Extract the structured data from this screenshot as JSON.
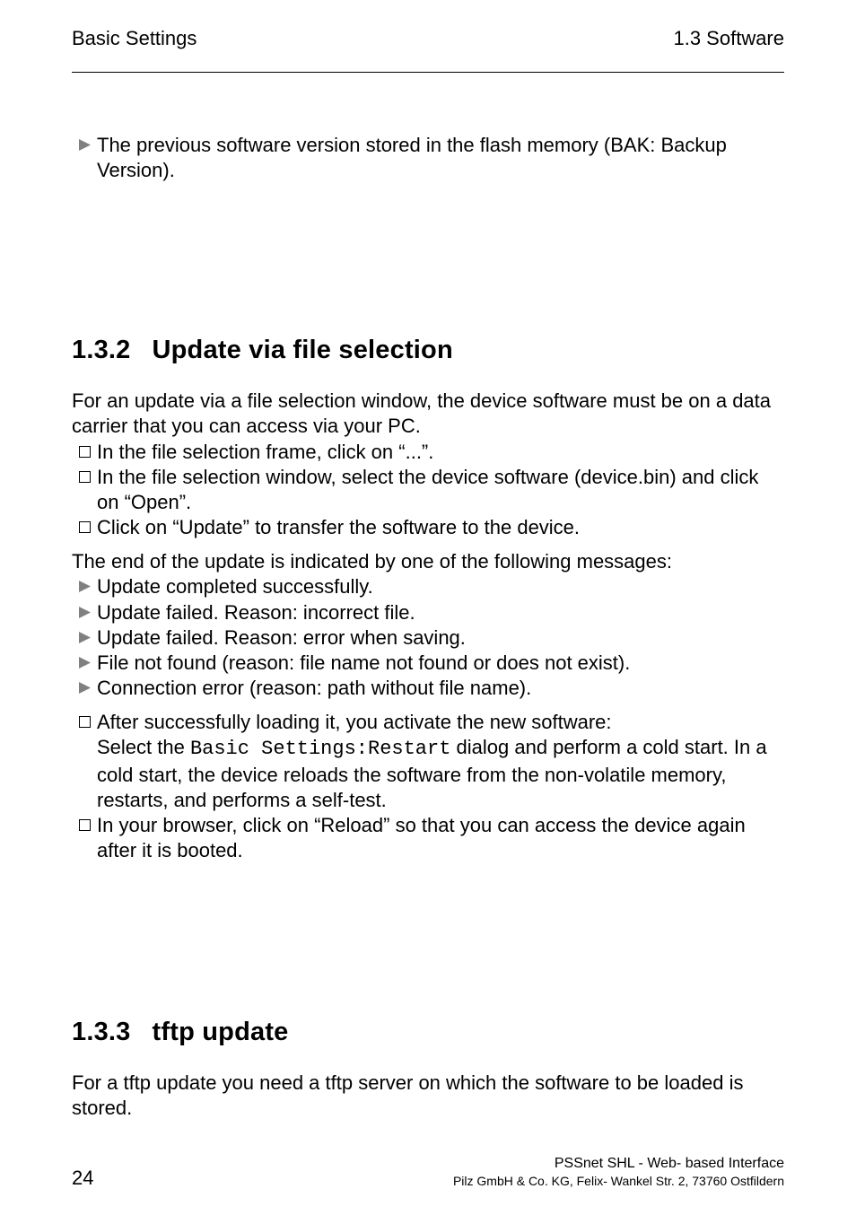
{
  "header": {
    "left": "Basic Settings",
    "right": "1.3  Software"
  },
  "intro_bullet": "The previous software version stored in the flash memory (BAK: Backup Version).",
  "section_132": {
    "number": "1.3.2",
    "title": "Update via file selection",
    "para1": "For an update via a file selection window, the device software must be on a data carrier that you can access via your PC.",
    "check1": "In the file selection frame, click on “...”.",
    "check2": "In the file selection window, select the device software (device.bin) and click on “Open”.",
    "check3": "Click on “Update” to transfer the software to the device.",
    "para2": "The end of the update is indicated by one of the following messages:",
    "tri1": "Update completed successfully.",
    "tri2": "Update failed. Reason: incorrect file.",
    "tri3": "Update failed. Reason: error when saving.",
    "tri4": "File not found (reason: file name not found or does not exist).",
    "tri5": "Connection error (reason: path without file name).",
    "check4_line1": "After successfully loading it, you activate the new software:",
    "check4_prefix": "Select the ",
    "check4_mono": "Basic Settings:Restart",
    "check4_suffix": " dialog and perform a cold start. In a cold start, the device reloads the software from the non-volatile memory, restarts, and performs a self-test.",
    "check5": "In your browser, click on “Reload” so that you can access the device again after it is booted."
  },
  "section_133": {
    "number": "1.3.3",
    "title": "tftp update",
    "para": "For a tftp update you need a tftp server on which the software to be loaded is stored."
  },
  "footer": {
    "page": "24",
    "line1": "PSSnet SHL - Web- based Interface",
    "line2": "Pilz GmbH & Co. KG, Felix- Wankel Str. 2, 73760 Ostfildern"
  }
}
